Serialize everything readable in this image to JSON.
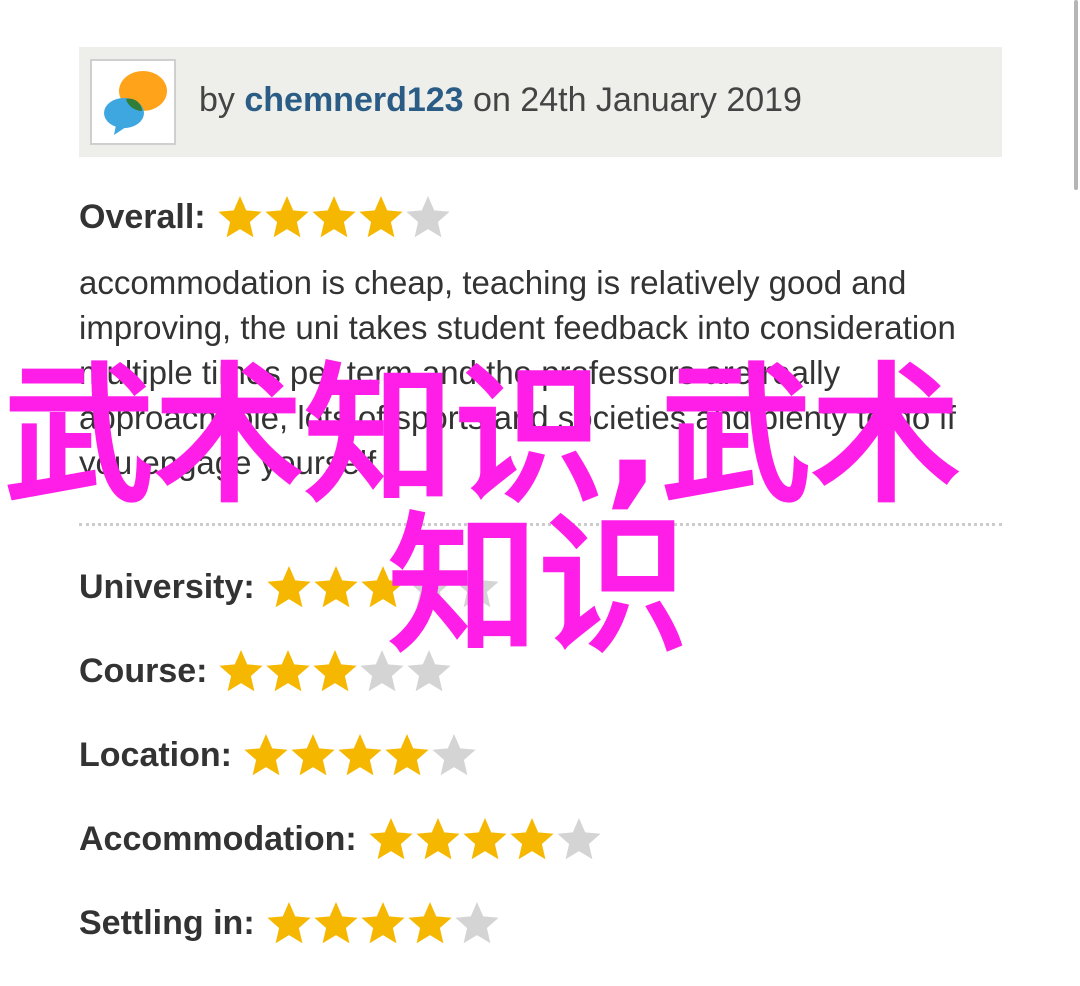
{
  "review": {
    "by_prefix": "by ",
    "author": "chemnerd123",
    "date_text": " on 24th January 2019",
    "overall_label": "Overall:",
    "overall_stars": 4,
    "text": "accommodation is cheap, teaching is relatively good and improving, the uni takes student feedback into consideration multiple times per term and the professors are really approachable, lots of sports and societies and plenty to do if you engage yourself"
  },
  "ratings": [
    {
      "label": "University:",
      "stars": 3
    },
    {
      "label": "Course:",
      "stars": 3
    },
    {
      "label": "Location:",
      "stars": 4
    },
    {
      "label": "Accommodation:",
      "stars": 4
    },
    {
      "label": "Settling in:",
      "stars": 4
    }
  ],
  "max_stars": 5,
  "watermark": {
    "line1": "武术知识,武术",
    "line2": "知识"
  },
  "colors": {
    "star_filled": "#f6b700",
    "star_empty": "#d4d4d4",
    "author_link": "#2a5c85",
    "watermark": "#ff1ee8",
    "header_bg": "#eeeeea"
  },
  "icons": {
    "avatar": "speech-bubbles-icon",
    "star": "star-icon"
  }
}
